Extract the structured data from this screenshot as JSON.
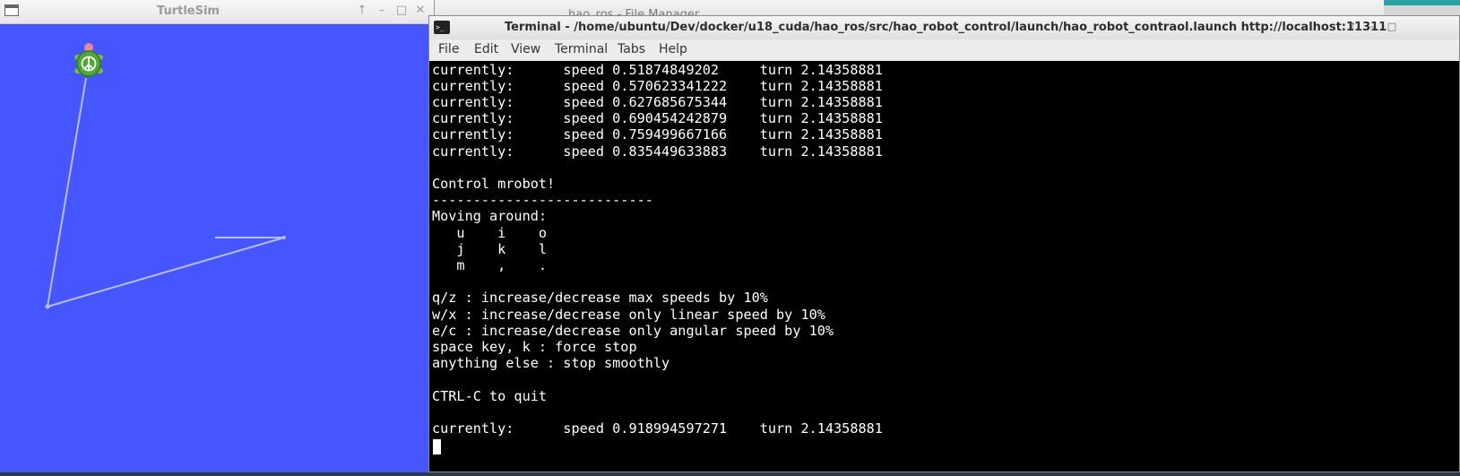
{
  "background_window": {
    "title": "hao_ros - File Manager",
    "buttons": [
      "↑",
      "–",
      "□",
      "✕"
    ]
  },
  "turtlesim": {
    "title": "TurtleSim",
    "buttons": {
      "keep_above": "↑",
      "minimize": "–",
      "maximize": "□",
      "close": "✕"
    },
    "background_color": "#4556ff",
    "pen_color": "#b8bfff",
    "turtle_icon": "turtle-icon"
  },
  "terminal": {
    "title": "Terminal - /home/ubuntu/Dev/docker/u18_cuda/hao_ros/src/hao_robot_control/launch/hao_robot_contraol.launch http://localhost:11311",
    "buttons": {
      "keep_above": "↑",
      "minimize": "–",
      "maximize": "□"
    },
    "menu": [
      "File",
      "Edit",
      "View",
      "Terminal",
      "Tabs",
      "Help"
    ],
    "lines": [
      "currently:      speed 0.51874849202     turn 2.14358881",
      "currently:      speed 0.570623341222    turn 2.14358881",
      "currently:      speed 0.627685675344    turn 2.14358881",
      "currently:      speed 0.690454242879    turn 2.14358881",
      "currently:      speed 0.759499667166    turn 2.14358881",
      "currently:      speed 0.835449633883    turn 2.14358881",
      "",
      "Control mrobot!",
      "---------------------------",
      "Moving around:",
      "   u    i    o",
      "   j    k    l",
      "   m    ,    .",
      "",
      "q/z : increase/decrease max speeds by 10%",
      "w/x : increase/decrease only linear speed by 10%",
      "e/c : increase/decrease only angular speed by 10%",
      "space key, k : force stop",
      "anything else : stop smoothly",
      "",
      "CTRL-C to quit",
      "",
      "currently:      speed 0.918994597271    turn 2.14358881"
    ]
  }
}
